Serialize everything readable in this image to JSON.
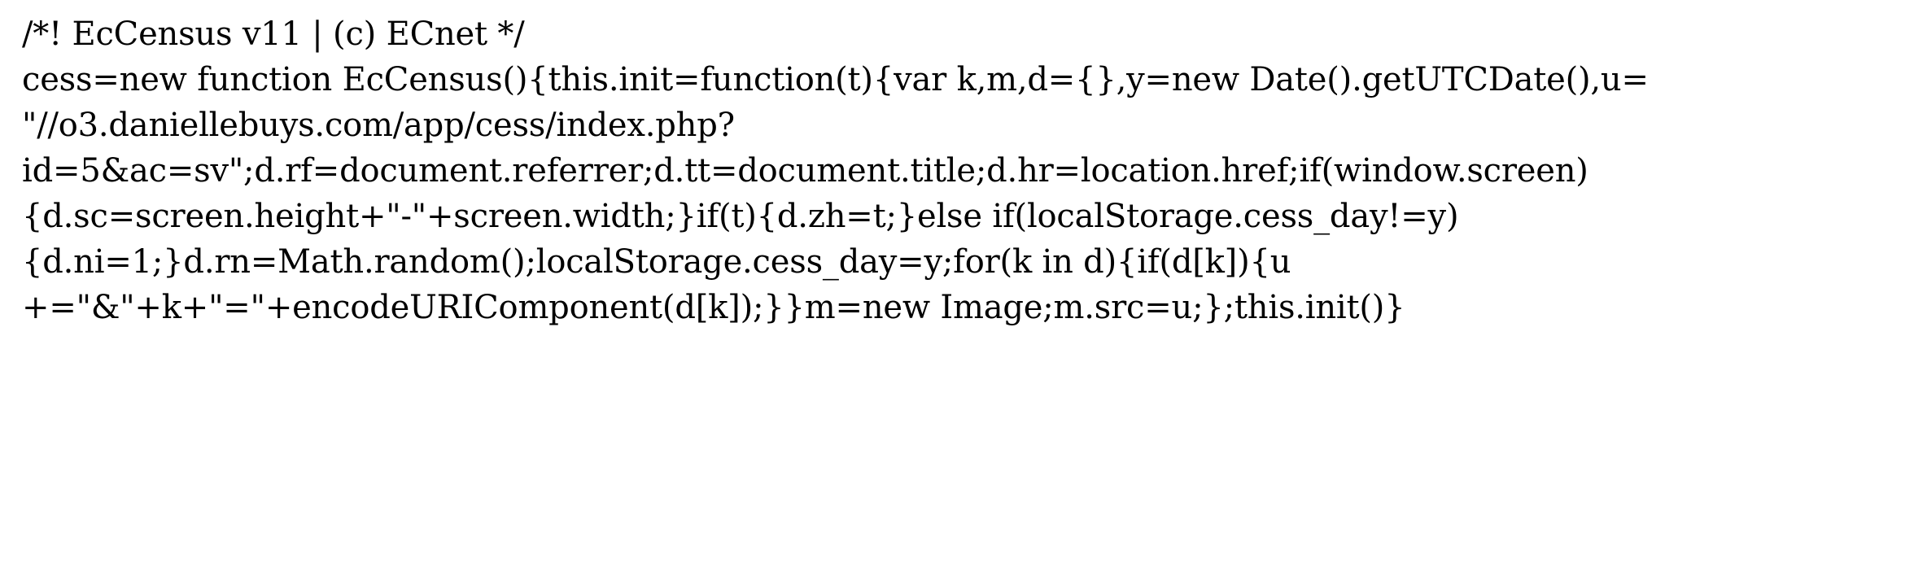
{
  "document": {
    "lines": [
      "/*! EcCensus v11 | (c) ECnet */",
      "cess=new function EcCensus(){this.init=function(t){var k,m,d={},y=new Date().getUTCDate(),u=",
      "\"//o3.daniellebuys.com/app/cess/index.php?",
      "id=5&ac=sv\";d.rf=document.referrer;d.tt=document.title;d.hr=location.href;if(window.screen)",
      "{d.sc=screen.height+\"-\"+screen.width;}if(t){d.zh=t;}else if(localStorage.cess_day!=y)",
      "{d.ni=1;}d.rn=Math.random();localStorage.cess_day=y;for(k in d){if(d[k]){u",
      "+=\"&\"+k+\"=\"+encodeURIComponent(d[k]);}}m=new Image;m.src=u;};this.init()}"
    ]
  }
}
